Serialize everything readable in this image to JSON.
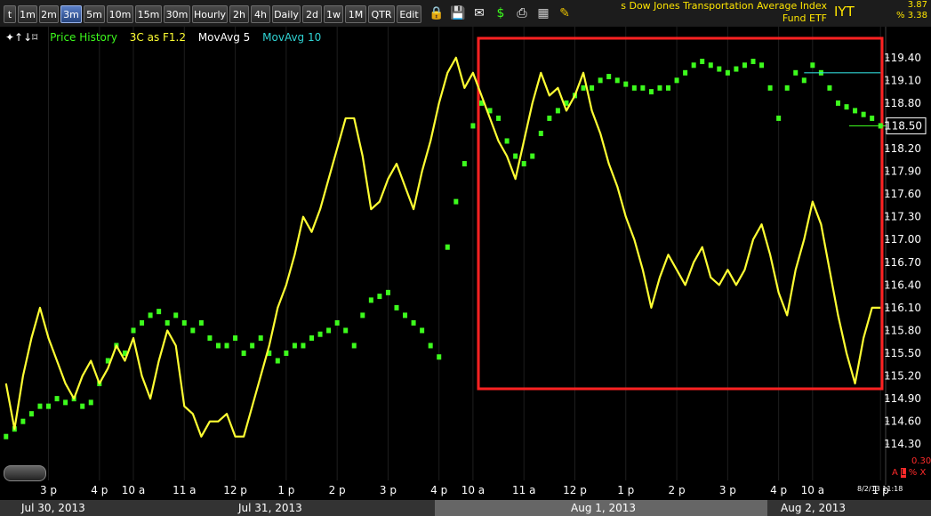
{
  "toolbar": {
    "timeframes": [
      "t",
      "1m",
      "2m",
      "3m",
      "5m",
      "10m",
      "15m",
      "30m",
      "Hourly",
      "2h",
      "4h",
      "Daily",
      "2d",
      "1w",
      "1M",
      "QTR",
      "Edit"
    ],
    "active_timeframe": "3m"
  },
  "header": {
    "title_line1": "s Dow Jones Transportation Average Index",
    "title_line2": "Fund ETF",
    "symbol": "IYT",
    "change": "3.87",
    "change_pct": "% 3.38"
  },
  "legend": {
    "price": "Price History",
    "three_c": "3C as F1.2",
    "ma5": "MovAvg 5",
    "ma10": "MovAvg 10"
  },
  "colors": {
    "price": "#3dfb1d",
    "three_c": "#ffff33",
    "ma10": "#2fd3d3",
    "highlight": "#ff2222"
  },
  "chart_data": {
    "type": "line",
    "y_ticks": [
      "119.40",
      "119.10",
      "118.80",
      "118.50",
      "118.20",
      "117.90",
      "117.60",
      "117.30",
      "117.00",
      "116.70",
      "116.40",
      "116.10",
      "115.80",
      "115.50",
      "115.20",
      "114.90",
      "114.60",
      "114.30"
    ],
    "ylim": [
      114.15,
      119.55
    ],
    "last_price": "118.50",
    "x_ticks": [
      "3 p",
      "4 p",
      "10 a",
      "11 a",
      "12 p",
      "1 p",
      "2 p",
      "3 p",
      "4 p",
      "10 a",
      "11 a",
      "12 p",
      "1 p",
      "2 p",
      "3 p",
      "4 p",
      "10 a",
      "1 p"
    ],
    "x_tick_index": [
      5,
      11,
      15,
      21,
      27,
      33,
      39,
      45,
      51,
      55,
      61,
      67,
      73,
      79,
      85,
      91,
      95,
      103
    ],
    "dates": [
      "Jul 30, 2013",
      "Jul 31, 2013",
      "Aug 1, 2013",
      "Aug 2, 2013"
    ],
    "date_index": [
      0,
      13,
      53,
      91
    ],
    "n_bars": 104,
    "series": [
      {
        "name": "Price History",
        "values": [
          114.4,
          114.5,
          114.6,
          114.7,
          114.8,
          114.8,
          114.9,
          114.85,
          114.9,
          114.8,
          114.85,
          115.1,
          115.4,
          115.6,
          115.5,
          115.8,
          115.9,
          116.0,
          116.05,
          115.9,
          116.0,
          115.9,
          115.8,
          115.9,
          115.7,
          115.6,
          115.6,
          115.7,
          115.5,
          115.6,
          115.7,
          115.5,
          115.4,
          115.5,
          115.6,
          115.6,
          115.7,
          115.75,
          115.8,
          115.9,
          115.8,
          115.6,
          116.0,
          116.2,
          116.25,
          116.3,
          116.1,
          116.0,
          115.9,
          115.8,
          115.6,
          115.45,
          116.9,
          117.5,
          118.0,
          118.5,
          118.8,
          118.7,
          118.6,
          118.3,
          118.1,
          118.0,
          118.1,
          118.4,
          118.6,
          118.7,
          118.8,
          118.9,
          119.0,
          119.0,
          119.1,
          119.15,
          119.1,
          119.05,
          119.0,
          119.0,
          118.95,
          119.0,
          119.0,
          119.1,
          119.2,
          119.3,
          119.35,
          119.3,
          119.25,
          119.2,
          119.25,
          119.3,
          119.35,
          119.3,
          119.0,
          118.6,
          119.0,
          119.2,
          119.1,
          119.3,
          119.2,
          119.0,
          118.8,
          118.75,
          118.7,
          118.65,
          118.6,
          118.5
        ]
      },
      {
        "name": "3C as F1.2",
        "values": [
          115.1,
          114.5,
          115.2,
          115.7,
          116.1,
          115.7,
          115.4,
          115.1,
          114.9,
          115.2,
          115.4,
          115.1,
          115.3,
          115.6,
          115.4,
          115.7,
          115.2,
          114.9,
          115.4,
          115.8,
          115.6,
          114.8,
          114.7,
          114.4,
          114.6,
          114.6,
          114.7,
          114.4,
          114.4,
          114.8,
          115.2,
          115.6,
          116.1,
          116.4,
          116.8,
          117.3,
          117.1,
          117.4,
          117.8,
          118.2,
          118.6,
          118.6,
          118.1,
          117.4,
          117.5,
          117.8,
          118.0,
          117.7,
          117.4,
          117.9,
          118.3,
          118.8,
          119.2,
          119.4,
          119.0,
          119.2,
          118.9,
          118.6,
          118.3,
          118.1,
          117.8,
          118.3,
          118.8,
          119.2,
          118.9,
          119.0,
          118.7,
          118.9,
          119.2,
          118.7,
          118.4,
          118.0,
          117.7,
          117.3,
          117.0,
          116.6,
          116.1,
          116.5,
          116.8,
          116.6,
          116.4,
          116.7,
          116.9,
          116.5,
          116.4,
          116.6,
          116.4,
          116.6,
          117.0,
          117.2,
          116.8,
          116.3,
          116.0,
          116.6,
          117.0,
          117.5,
          117.2,
          116.6,
          116.0,
          115.5,
          115.1,
          115.7,
          116.1,
          116.1
        ]
      },
      {
        "name": "MovAvg 10",
        "values": [
          119.2,
          119.2,
          119.2,
          119.2,
          119.2,
          119.2,
          119.2,
          119.2,
          119.2,
          119.2
        ]
      }
    ]
  }
}
